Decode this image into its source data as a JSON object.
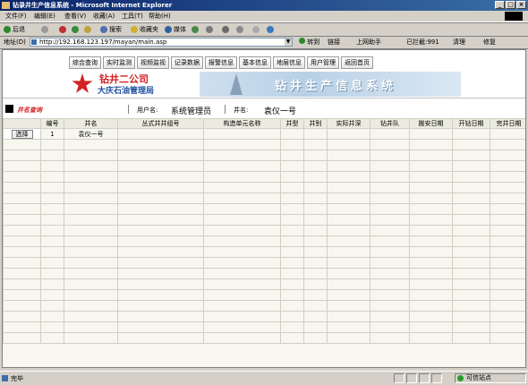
{
  "window": {
    "title": "钻录井生产信息系统 - Microsoft Internet Explorer",
    "controls": [
      "_",
      "□",
      "×"
    ]
  },
  "menu": [
    {
      "label": "文件(F)"
    },
    {
      "label": "编辑(E)"
    },
    {
      "label": "查看(V)"
    },
    {
      "label": "收藏(A)"
    },
    {
      "label": "工具(T)"
    },
    {
      "label": "帮助(H)"
    }
  ],
  "toolbar": {
    "back": "后退",
    "search": "搜索",
    "favorites": "收藏夹",
    "media": "媒体",
    "links": "链接",
    "online_assistant": "上网助手",
    "blocked": "已拦截:991",
    "clean": "清理",
    "repair": "修复"
  },
  "address": {
    "label": "地址(D)",
    "url": "http://192.168.123.197/mayan/main.asp",
    "go": "转到",
    "links_label": "链接"
  },
  "nav": [
    {
      "label": "综合查询"
    },
    {
      "label": "实时监测"
    },
    {
      "label": "视频监视"
    },
    {
      "label": "记录数据"
    },
    {
      "label": "报警信息"
    },
    {
      "label": "基本信息"
    },
    {
      "label": "地层信息"
    },
    {
      "label": "用户管理"
    },
    {
      "label": "返回首页"
    }
  ],
  "logo": {
    "line1": "钻井二公司",
    "line2": "大庆石油管理局"
  },
  "banner": {
    "text": "钻井生产信息系统"
  },
  "query": {
    "title": "井名查询",
    "user_label": "用户名:",
    "user_value": "系统管理员",
    "well_label": "井名:",
    "well_value": "袁仪一号"
  },
  "table": {
    "columns": [
      "",
      "编号",
      "井名",
      "丛式井井组号",
      "构造单元名称",
      "井型",
      "井别",
      "实际井深",
      "钻井队",
      "搬安日期",
      "开钻日期",
      "完井日期"
    ],
    "rows": [
      {
        "select": "选择",
        "id": "1",
        "name": "袁仪一号"
      }
    ]
  },
  "status": {
    "text": "完毕",
    "zone": "可信站点"
  }
}
